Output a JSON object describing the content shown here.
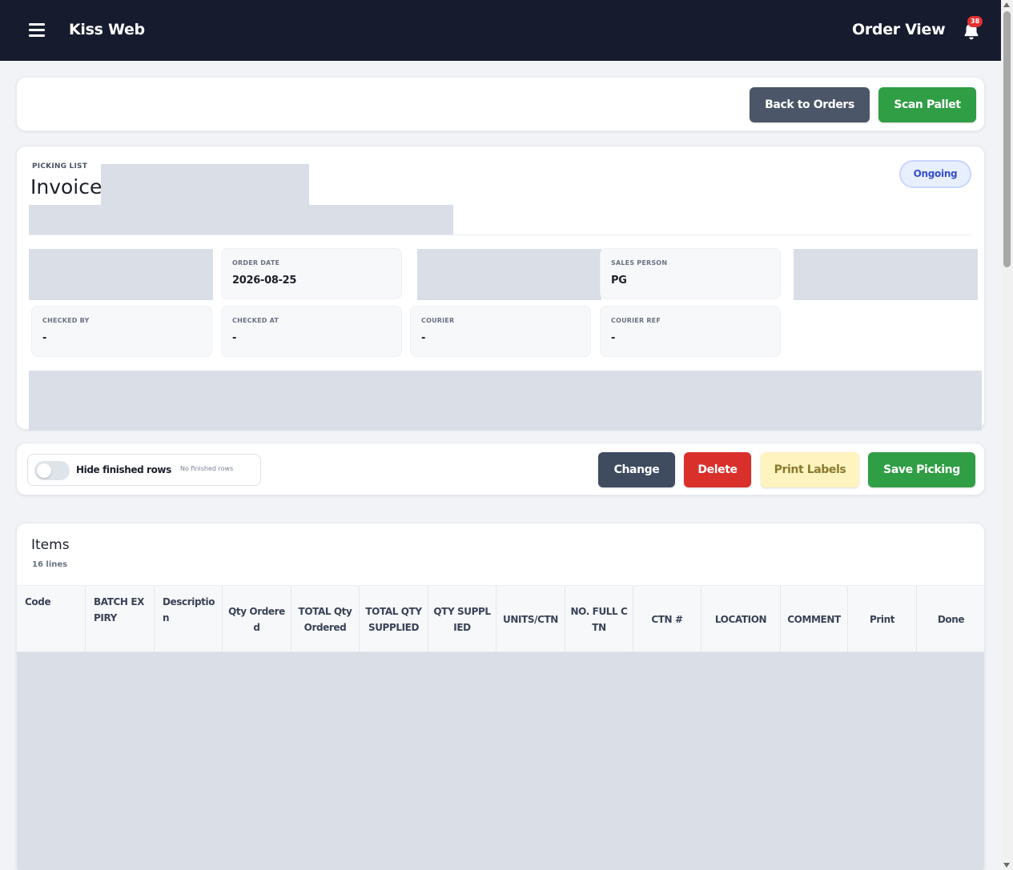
{
  "topbar": {
    "brand": "Kiss Web",
    "page_title": "Order View",
    "notification_count": "38",
    "menu_icon": "hamburger-icon",
    "bell_icon": "bell-icon"
  },
  "actions": {
    "back_label": "Back to Orders",
    "scan_label": "Scan Pallet"
  },
  "picking": {
    "eyebrow": "PICKING LIST",
    "title": "Invoice",
    "status": "Ongoing",
    "info": [
      {
        "label": "ORDER DATE",
        "value": "2026-08-25"
      },
      {
        "label": "SALES PERSON",
        "value": "PG"
      },
      {
        "label": "CHECKED BY",
        "value": "-"
      },
      {
        "label": "CHECKED AT",
        "value": "-"
      },
      {
        "label": "COURIER",
        "value": "-"
      },
      {
        "label": "COURIER REF",
        "value": "-"
      }
    ]
  },
  "controls": {
    "toggle_label": "Hide finished rows",
    "toggle_hint": "No finished rows",
    "change_label": "Change",
    "delete_label": "Delete",
    "print_label": "Print Labels",
    "save_label": "Save Picking"
  },
  "items": {
    "title": "Items",
    "count": "16 lines",
    "columns": [
      "Code",
      "BATCH EXPIRY",
      "Description",
      "Qty Ordered",
      "TOTAL Qty Ordered",
      "TOTAL QTY SUPPLIED",
      "QTY SUPPLIED",
      "UNITS/CTN",
      "NO. FULL CTN",
      "CTN #",
      "LOCATION",
      "COMMENT",
      "Print",
      "Done"
    ]
  },
  "colors": {
    "topbar": "#161b2e",
    "primary_green": "#2f9e44",
    "danger_red": "#d9302c",
    "slate": "#4b5668",
    "warning_yellow": "#fff3bf",
    "status_blue": "#3550c9"
  }
}
